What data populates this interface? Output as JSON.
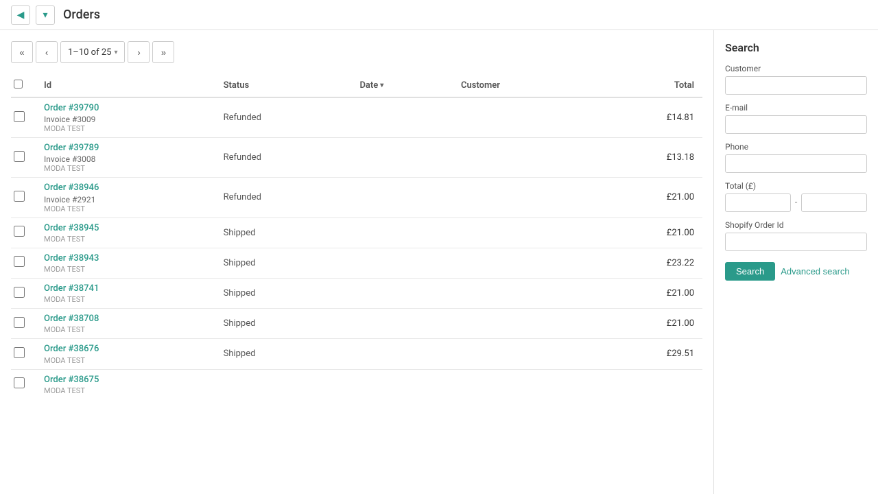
{
  "header": {
    "title": "Orders",
    "back_label": "←",
    "dropdown_label": "▾"
  },
  "pagination": {
    "first_label": "«",
    "prev_label": "‹",
    "range_label": "1–10 of 25",
    "range_arrow": "▾",
    "next_label": "›",
    "last_label": "»"
  },
  "table": {
    "columns": [
      {
        "key": "check",
        "label": ""
      },
      {
        "key": "id",
        "label": "Id"
      },
      {
        "key": "status",
        "label": "Status"
      },
      {
        "key": "date",
        "label": "Date"
      },
      {
        "key": "customer",
        "label": "Customer"
      },
      {
        "key": "total",
        "label": "Total"
      }
    ],
    "rows": [
      {
        "order": "Order #39790",
        "invoice": "Invoice #3009",
        "store": "MODA TEST",
        "status": "Refunded",
        "date": "",
        "customer": "",
        "total": "£14.81"
      },
      {
        "order": "Order #39789",
        "invoice": "Invoice #3008",
        "store": "MODA TEST",
        "status": "Refunded",
        "date": "",
        "customer": "",
        "total": "£13.18"
      },
      {
        "order": "Order #38946",
        "invoice": "Invoice #2921",
        "store": "MODA TEST",
        "status": "Refunded",
        "date": "",
        "customer": "",
        "total": "£21.00"
      },
      {
        "order": "Order #38945",
        "invoice": "",
        "store": "MODA TEST",
        "status": "Shipped",
        "date": "",
        "customer": "",
        "total": "£21.00"
      },
      {
        "order": "Order #38943",
        "invoice": "",
        "store": "MODA TEST",
        "status": "Shipped",
        "date": "",
        "customer": "",
        "total": "£23.22"
      },
      {
        "order": "Order #38741",
        "invoice": "",
        "store": "MODA TEST",
        "status": "Shipped",
        "date": "",
        "customer": "",
        "total": "£21.00"
      },
      {
        "order": "Order #38708",
        "invoice": "",
        "store": "MODA TEST",
        "status": "Shipped",
        "date": "",
        "customer": "",
        "total": "£21.00"
      },
      {
        "order": "Order #38676",
        "invoice": "",
        "store": "MODA TEST",
        "status": "Shipped",
        "date": "",
        "customer": "",
        "total": "£29.51"
      },
      {
        "order": "Order #38675",
        "invoice": "",
        "store": "MODA TEST",
        "status": "",
        "date": "",
        "customer": "",
        "total": ""
      }
    ]
  },
  "search_panel": {
    "title": "Search",
    "customer_label": "Customer",
    "customer_placeholder": "",
    "email_label": "E-mail",
    "email_placeholder": "",
    "phone_label": "Phone",
    "phone_placeholder": "",
    "total_label": "Total (£)",
    "total_from_placeholder": "",
    "total_to_placeholder": "",
    "shopify_label": "Shopify Order Id",
    "shopify_placeholder": "",
    "search_btn": "Search",
    "advanced_btn": "Advanced search"
  }
}
